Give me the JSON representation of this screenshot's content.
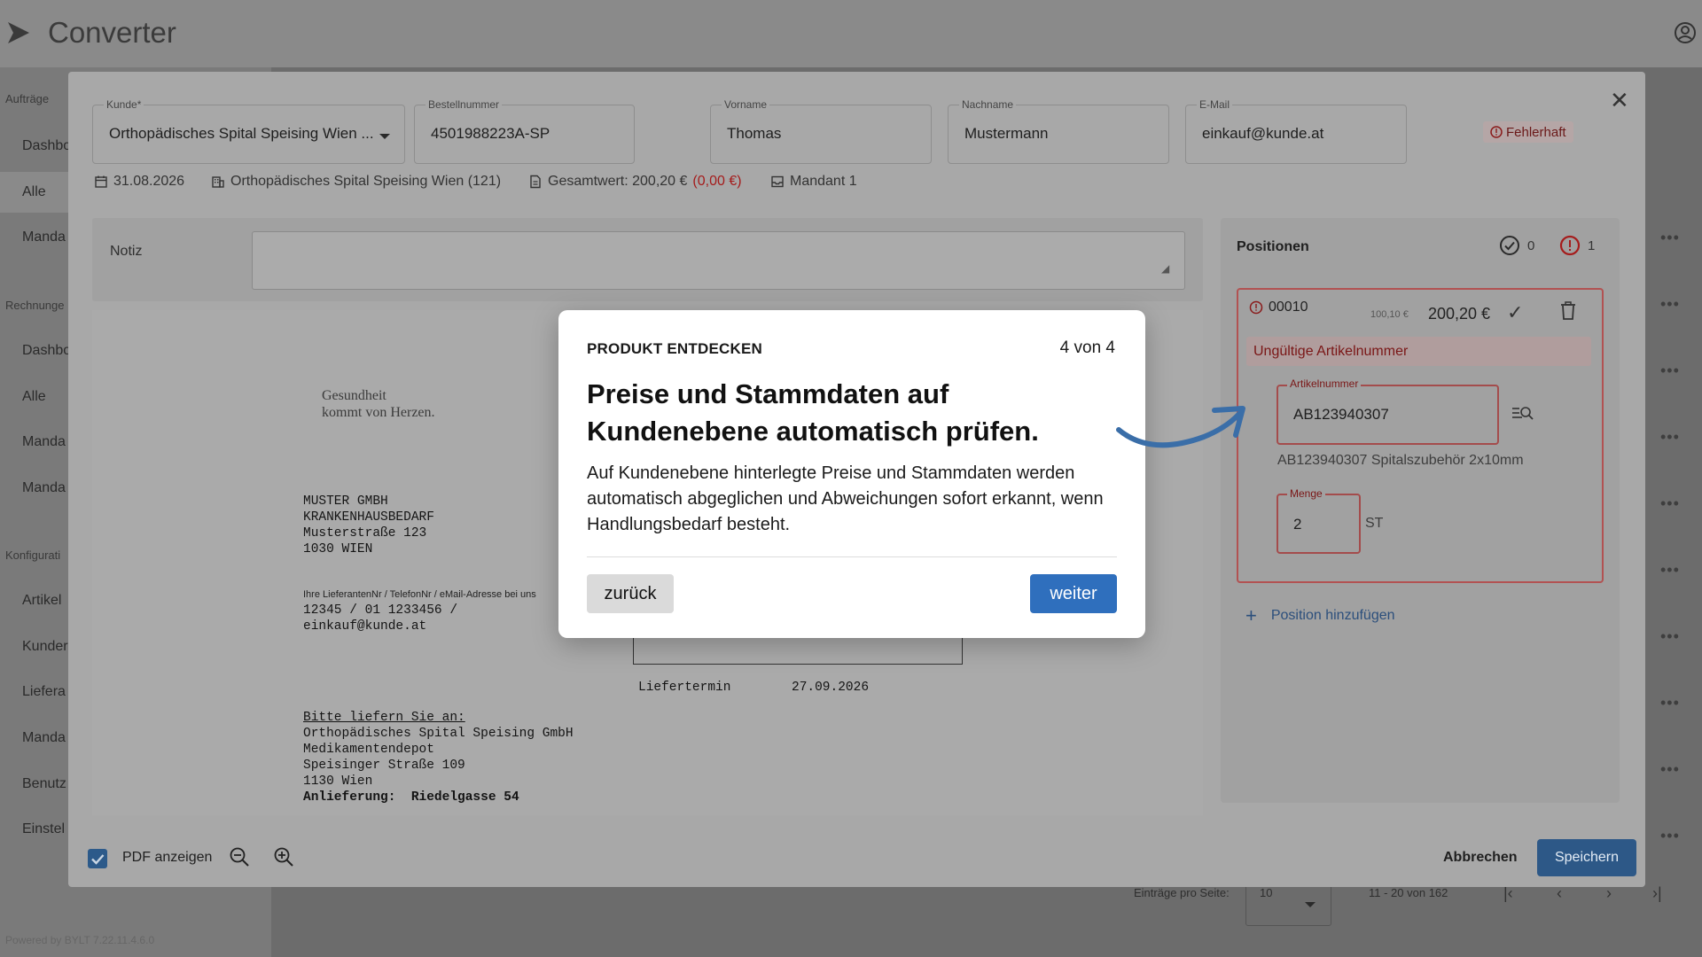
{
  "app": {
    "title": "Converter"
  },
  "sidebar": {
    "sections": [
      "Aufträge",
      "Rechnunge",
      "Konfigurati"
    ],
    "items": [
      "Dashbo",
      "Alle",
      "Manda",
      "Dashbo",
      "Alle",
      "Manda",
      "Manda",
      "Artikel",
      "Kunder",
      "Liefera",
      "Manda",
      "Benutz",
      "Einstel"
    ],
    "powered": "Powered by BYLT   7.22.11.4.6.0"
  },
  "form": {
    "kunde": {
      "label": "Kunde*",
      "value": "Orthopädisches Spital Speising Wien ..."
    },
    "bestellnummer": {
      "label": "Bestellnummer",
      "value": "4501988223A-SP"
    },
    "vorname": {
      "label": "Vorname",
      "value": "Thomas"
    },
    "nachname": {
      "label": "Nachname",
      "value": "Mustermann"
    },
    "email": {
      "label": "E-Mail",
      "value": "einkauf@kunde.at"
    },
    "status_badge": "Fehlerhaft"
  },
  "meta": {
    "date": "31.08.2026",
    "customer": "Orthopädisches Spital Speising Wien (121)",
    "total": "Gesamtwert: 200,20 €",
    "total_diff": "(0,00 €)",
    "mandant": "Mandant 1"
  },
  "notiz": {
    "label": "Notiz",
    "value": ""
  },
  "document": {
    "slogan": "Gesundheit\nkommt von Herzen.",
    "address": "MUSTER GMBH\nKRANKENHAUSBEDARF\nMusterstraße 123\n1030 WIEN",
    "supplier_note": "Ihre LieferantenNr / TelefonNr / eMail-Adresse bei uns",
    "supplier_data": "12345 / 01 1233456 /\neinkauf@kunde.at",
    "delivery_label": "Liefertermin",
    "delivery_date": "27.09.2026",
    "ship_to_heading": "Bitte liefern Sie an:",
    "ship_to": "Orthopädisches Spital Speising GmbH\nMedikamentendepot\nSpeisinger Straße 109\n1130 Wien",
    "anlieferung": "Anlieferung:  Riedelgasse 54"
  },
  "positions": {
    "title": "Positionen",
    "ok_count": "0",
    "error_count": "1",
    "item": {
      "id": "00010",
      "old_price": "100,10 €",
      "price": "200,20 €",
      "error": "Ungültige Artikelnummer",
      "article_label": "Artikelnummer",
      "article_value": "AB123940307",
      "article_desc": "AB123940307 Spitalszubehör 2x10mm",
      "qty_label": "Menge",
      "qty_value": "2",
      "qty_unit": "ST"
    },
    "add_label": "Position hinzufügen"
  },
  "footer": {
    "pdf_label": "PDF anzeigen",
    "cancel": "Abbrechen",
    "save": "Speichern"
  },
  "pager": {
    "per_page_label": "Einträge pro Seite:",
    "per_page_value": "10",
    "range": "11 - 20 von 162"
  },
  "tour": {
    "kicker": "PRODUKT ENTDECKEN",
    "step": "4 von 4",
    "title": "Preise und Stammdaten auf Kundenebene automatisch prüfen.",
    "body": "Auf Kundenebene hinterlegte Preise und Stammdaten werden automatisch abgeglichen und Abweichungen sofort erkannt, wenn Handlungsbedarf besteht.",
    "back": "zurück",
    "next": "weiter"
  },
  "colors": {
    "primary": "#2f6fbd",
    "error": "#a51c1c",
    "overlay": "#6c6c6c"
  }
}
